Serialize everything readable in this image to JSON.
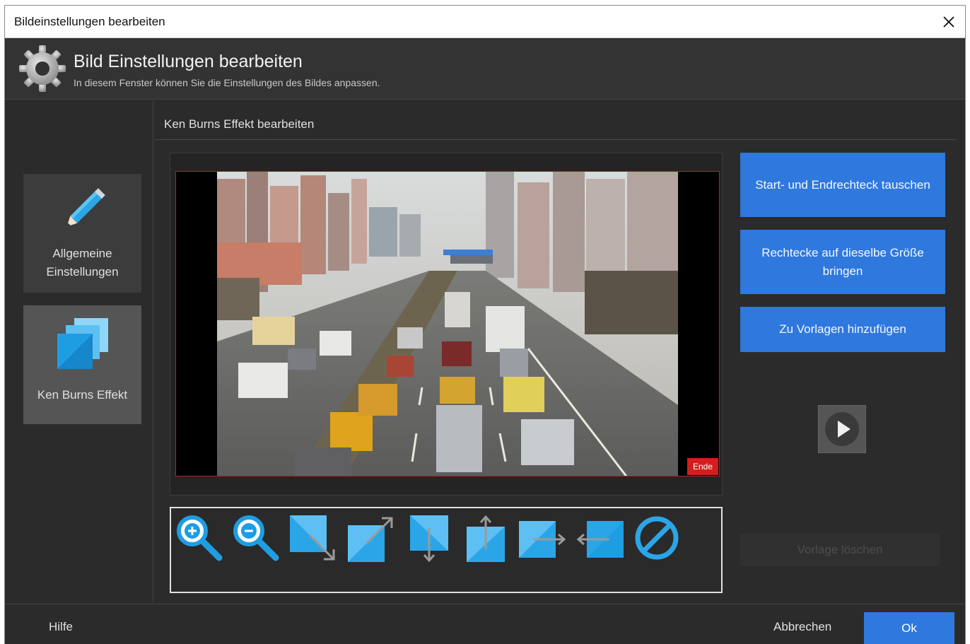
{
  "window": {
    "title": "Bildeinstellungen bearbeiten",
    "close_icon": "close-icon"
  },
  "header": {
    "icon": "gear-icon",
    "title": "Bild Einstellungen bearbeiten",
    "subtitle": "In diesem Fenster können Sie die Einstellungen des Bildes anpassen."
  },
  "sidebar": {
    "items": [
      {
        "label_line1": "Allgemeine",
        "label_line2": "Einstellungen",
        "icon": "pencil-icon",
        "active": false
      },
      {
        "label": "Ken Burns Effekt",
        "icon": "ken-burns-icon",
        "active": true
      }
    ]
  },
  "section": {
    "title": "Ken Burns Effekt bearbeiten"
  },
  "preview": {
    "end_tag": "Ende",
    "image": "traffic-photo"
  },
  "toolbar": {
    "tools": [
      "zoom-in-icon",
      "zoom-out-icon",
      "expand-bottom-right-icon",
      "expand-top-right-icon",
      "expand-down-icon",
      "expand-up-icon",
      "move-right-icon",
      "move-left-icon",
      "reset-icon"
    ]
  },
  "actions": {
    "swap_label": "Start- und Endrechteck tauschen",
    "same_size_line1": "Rechtecke auf dieselbe Größe",
    "same_size_line2": "bringen",
    "add_template_label": "Zu Vorlagen hinzufügen",
    "play_icon": "play-icon",
    "delete_template_label": "Vorlage löschen"
  },
  "footer": {
    "help_label": "Hilfe",
    "cancel_label": "Abbrechen",
    "ok_label": "Ok"
  },
  "colors": {
    "accent": "#2f78dd",
    "background": "#2b2b2b",
    "end_marker": "#d21e1e",
    "icon_blue": "#2aa6e8"
  }
}
